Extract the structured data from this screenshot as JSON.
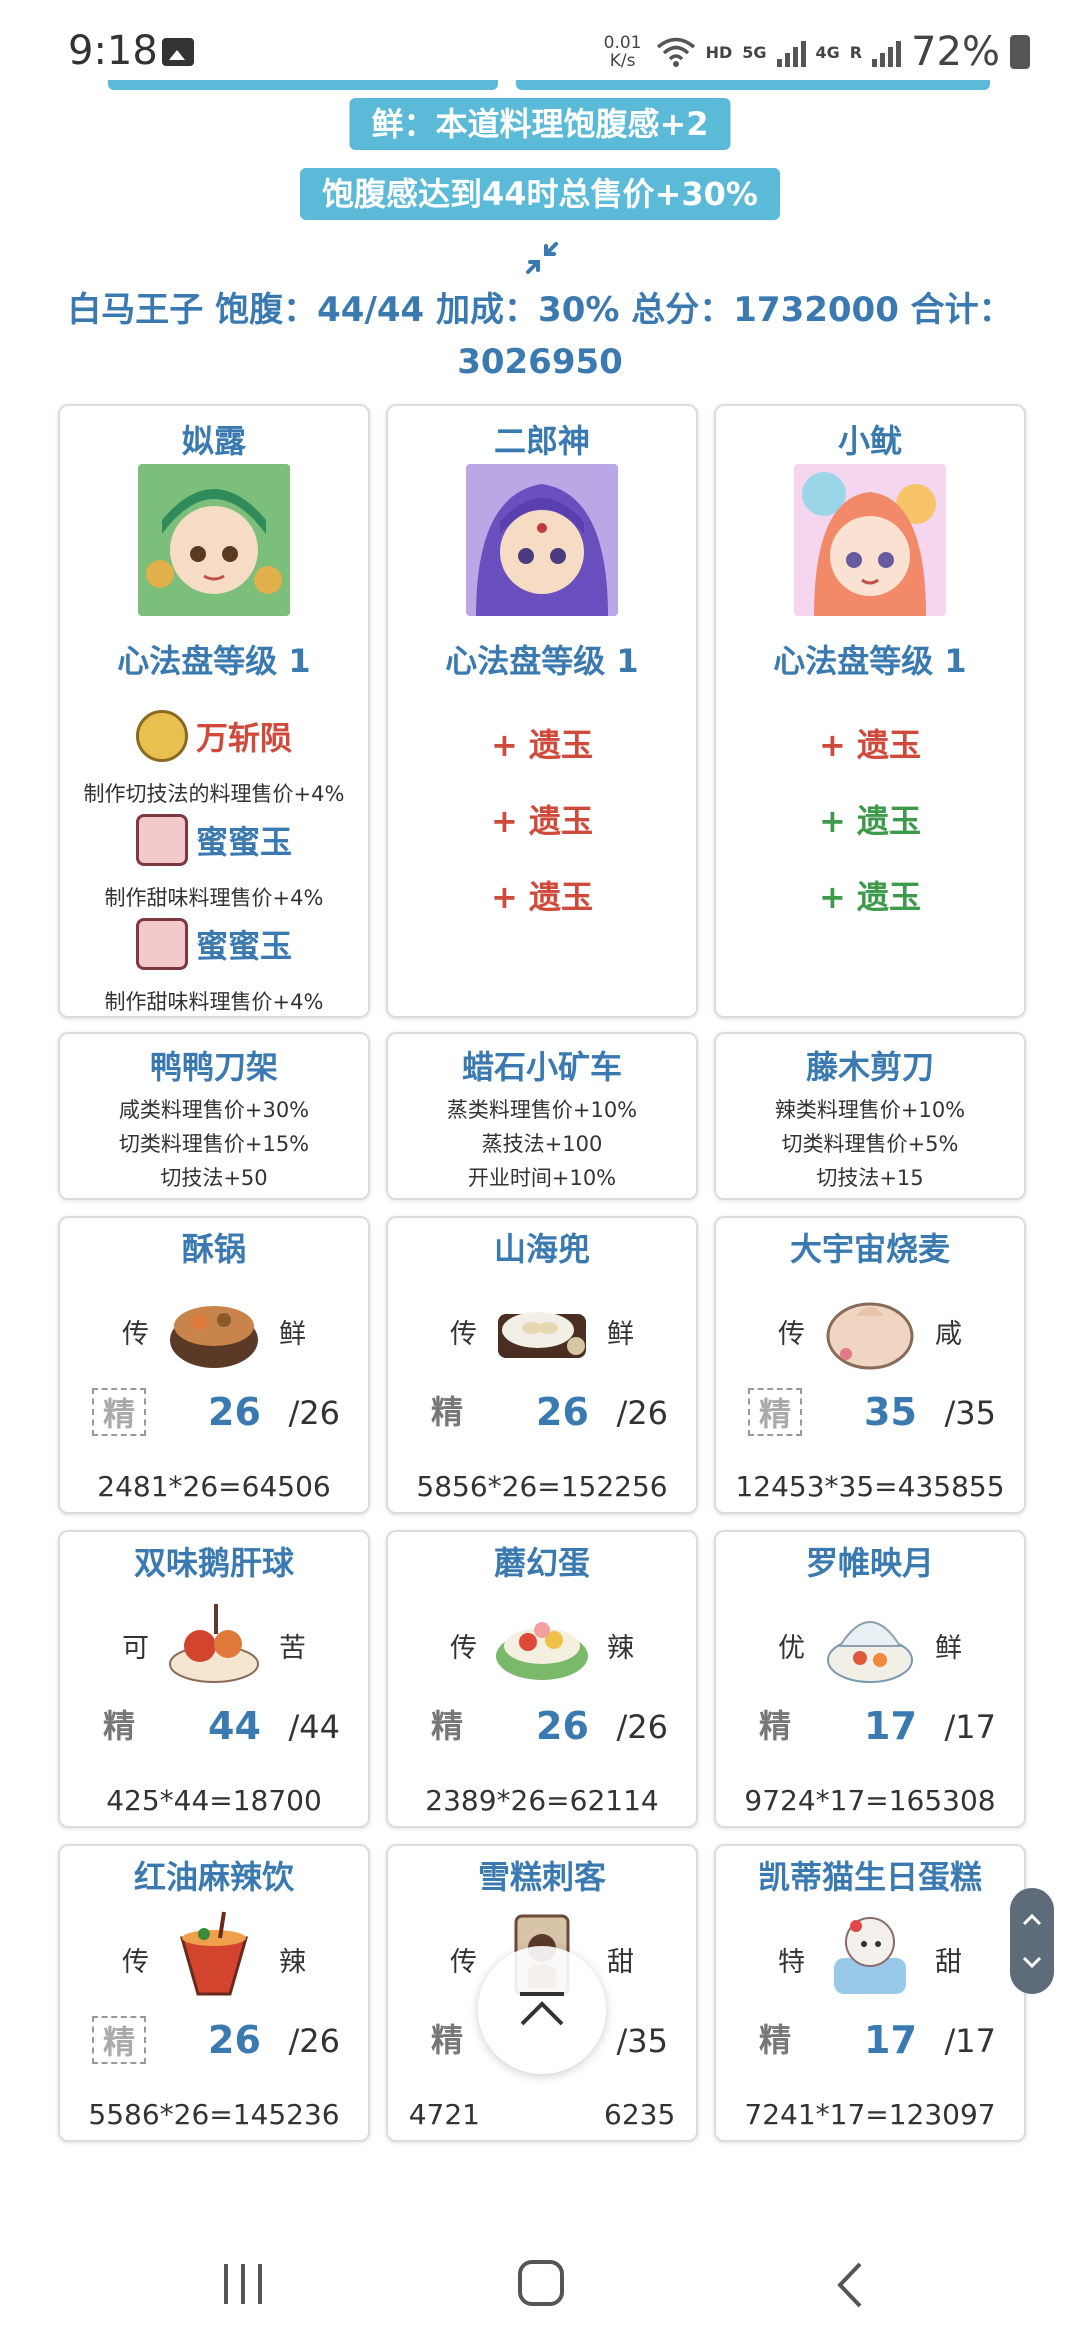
{
  "status_bar": {
    "time": "9:18",
    "net_speed_value": "0.01",
    "net_speed_unit": "K/s",
    "hd": "HD",
    "sig1": "5G",
    "sig2": "4G",
    "sig2_r": "R",
    "battery": "72%",
    "icons": [
      "gallery-icon",
      "wifi-icon",
      "signal-icon",
      "battery-icon"
    ]
  },
  "banners": {
    "fresh": "鲜：本道料理饱腹感+2",
    "full": "饱腹感达到44时总售价+30%"
  },
  "summary": {
    "line1": "白马王子 饱腹：44/44 加成：30% 总分：1732000 合计：",
    "line2": "3026950"
  },
  "chefs": [
    {
      "name": "姒露",
      "level": "心法盘等级 1",
      "skills": [
        {
          "name": "万斩陨",
          "desc": "制作切技法的料理售价+4%",
          "color": "#d04a3c"
        },
        {
          "name": "蜜蜜玉",
          "desc": "制作甜味料理售价+4%",
          "color": "#3a7ab0"
        },
        {
          "name": "蜜蜜玉",
          "desc": "制作甜味料理售价+4%",
          "color": "#3a7ab0"
        }
      ]
    },
    {
      "name": "二郎神",
      "level": "心法盘等级 1",
      "jades": [
        {
          "text": "+ 遗玉",
          "color": "#d04a3c"
        },
        {
          "text": "+ 遗玉",
          "color": "#d04a3c"
        },
        {
          "text": "+ 遗玉",
          "color": "#d04a3c"
        }
      ]
    },
    {
      "name": "小鱿",
      "level": "心法盘等级 1",
      "jades": [
        {
          "text": "+ 遗玉",
          "color": "#d04a3c"
        },
        {
          "text": "+ 遗玉",
          "color": "#3c9a4a"
        },
        {
          "text": "+ 遗玉",
          "color": "#3c9a4a"
        }
      ]
    }
  ],
  "equips": [
    {
      "name": "鸭鸭刀架",
      "lines": [
        "咸类料理售价+30%",
        "切类料理售价+15%",
        "切技法+50"
      ]
    },
    {
      "name": "蜡石小矿车",
      "lines": [
        "蒸类料理售价+10%",
        "蒸技法+100",
        "开业时间+10%"
      ]
    },
    {
      "name": "藤木剪刀",
      "lines": [
        "辣类料理售价+10%",
        "切类料理售价+5%",
        "切技法+15"
      ]
    }
  ],
  "dishes": [
    {
      "name": "酥锅",
      "rarity": "传",
      "flavor": "鲜",
      "quality": "精",
      "count": "26",
      "max": "/26",
      "calc": "2481*26=64506",
      "dashed": true
    },
    {
      "name": "山海兜",
      "rarity": "传",
      "flavor": "鲜",
      "quality": "精",
      "count": "26",
      "max": "/26",
      "calc": "5856*26=152256",
      "dashed": false
    },
    {
      "name": "大宇宙烧麦",
      "rarity": "传",
      "flavor": "咸",
      "quality": "精",
      "count": "35",
      "max": "/35",
      "calc": "12453*35=435855",
      "dashed": true
    },
    {
      "name": "双味鹅肝球",
      "rarity": "可",
      "flavor": "苦",
      "quality": "精",
      "count": "44",
      "max": "/44",
      "calc": "425*44=18700",
      "dashed": false
    },
    {
      "name": "蘑幻蛋",
      "rarity": "传",
      "flavor": "辣",
      "quality": "精",
      "count": "26",
      "max": "/26",
      "calc": "2389*26=62114",
      "dashed": false
    },
    {
      "name": "罗帷映月",
      "rarity": "优",
      "flavor": "鲜",
      "quality": "精",
      "count": "17",
      "max": "/17",
      "calc": "9724*17=165308",
      "dashed": false
    },
    {
      "name": "红油麻辣饮",
      "rarity": "传",
      "flavor": "辣",
      "quality": "精",
      "count": "26",
      "max": "/26",
      "calc": "5586*26=145236",
      "dashed": true
    },
    {
      "name": "雪糕刺客",
      "rarity": "传",
      "flavor": "甜",
      "quality": "精",
      "count": "",
      "max": "/35",
      "calc_left": "4721",
      "calc_right": "6235",
      "dashed": false
    },
    {
      "name": "凯蒂猫生日蛋糕",
      "rarity": "特",
      "flavor": "甜",
      "quality": "精",
      "count": "17",
      "max": "/17",
      "calc": "7241*17=123097",
      "dashed": false
    }
  ],
  "colors": {
    "accent_blue": "#3a7ab0",
    "banner_bg": "#5bbad8",
    "red": "#d04a3c",
    "green": "#3c9a4a"
  }
}
